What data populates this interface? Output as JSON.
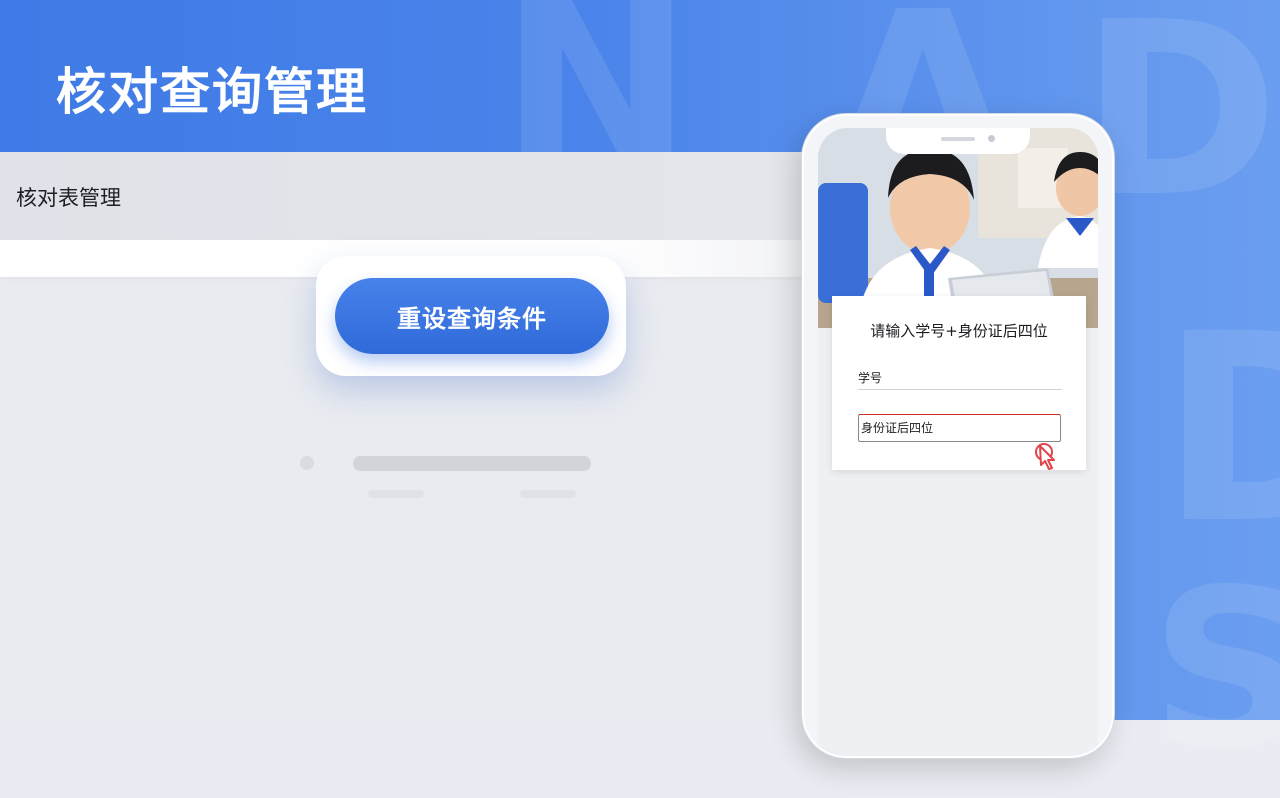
{
  "page": {
    "title": "核对查询管理"
  },
  "panel": {
    "header_title": "核对表管理",
    "reset_button_label": "重设查询条件"
  },
  "phone": {
    "form_title": "请输入学号+身份证后四位",
    "student_id_label": "学号",
    "id_last4_placeholder": "身份证后四位"
  },
  "colors": {
    "brand_blue": "#3f7ae6",
    "button_blue": "#2f6ad9",
    "panel_gray": "#e9ebf0",
    "focus_red": "#c9302c"
  },
  "icons": [
    "pointer-cursor-icon",
    "photo-students"
  ]
}
